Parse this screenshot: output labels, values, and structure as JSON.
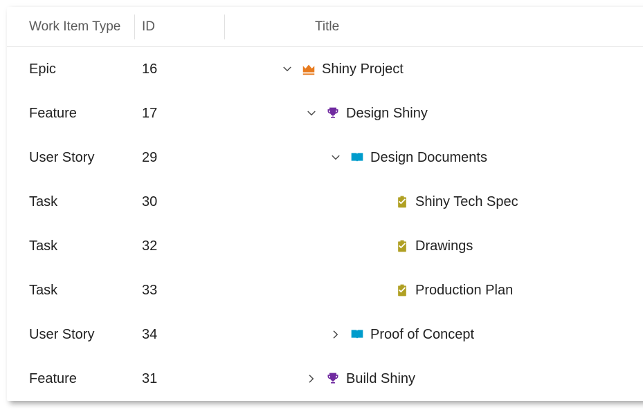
{
  "columns": {
    "type": "Work Item Type",
    "id": "ID",
    "title": "Title"
  },
  "rows": [
    {
      "type": "Epic",
      "id": "16",
      "title": "Shiny Project",
      "icon": "crown",
      "indent": 0,
      "expanded": true,
      "hasChildren": true
    },
    {
      "type": "Feature",
      "id": "17",
      "title": "Design Shiny",
      "icon": "trophy",
      "indent": 1,
      "expanded": true,
      "hasChildren": true
    },
    {
      "type": "User Story",
      "id": "29",
      "title": "Design Documents",
      "icon": "book",
      "indent": 2,
      "expanded": true,
      "hasChildren": true
    },
    {
      "type": "Task",
      "id": "30",
      "title": "Shiny Tech Spec",
      "icon": "clipboard",
      "indent": 3,
      "expanded": false,
      "hasChildren": false
    },
    {
      "type": "Task",
      "id": "32",
      "title": "Drawings",
      "icon": "clipboard",
      "indent": 3,
      "expanded": false,
      "hasChildren": false
    },
    {
      "type": "Task",
      "id": "33",
      "title": "Production Plan",
      "icon": "clipboard",
      "indent": 3,
      "expanded": false,
      "hasChildren": false
    },
    {
      "type": "User Story",
      "id": "34",
      "title": "Proof of Concept",
      "icon": "book",
      "indent": 2,
      "expanded": false,
      "hasChildren": true
    },
    {
      "type": "Feature",
      "id": "31",
      "title": "Build Shiny",
      "icon": "trophy",
      "indent": 1,
      "expanded": false,
      "hasChildren": true
    }
  ],
  "colors": {
    "crown": "#e87b1e",
    "trophy": "#702aa0",
    "book": "#009ccc",
    "clipboard": "#b0a023",
    "chevron": "#4a4a4a"
  }
}
